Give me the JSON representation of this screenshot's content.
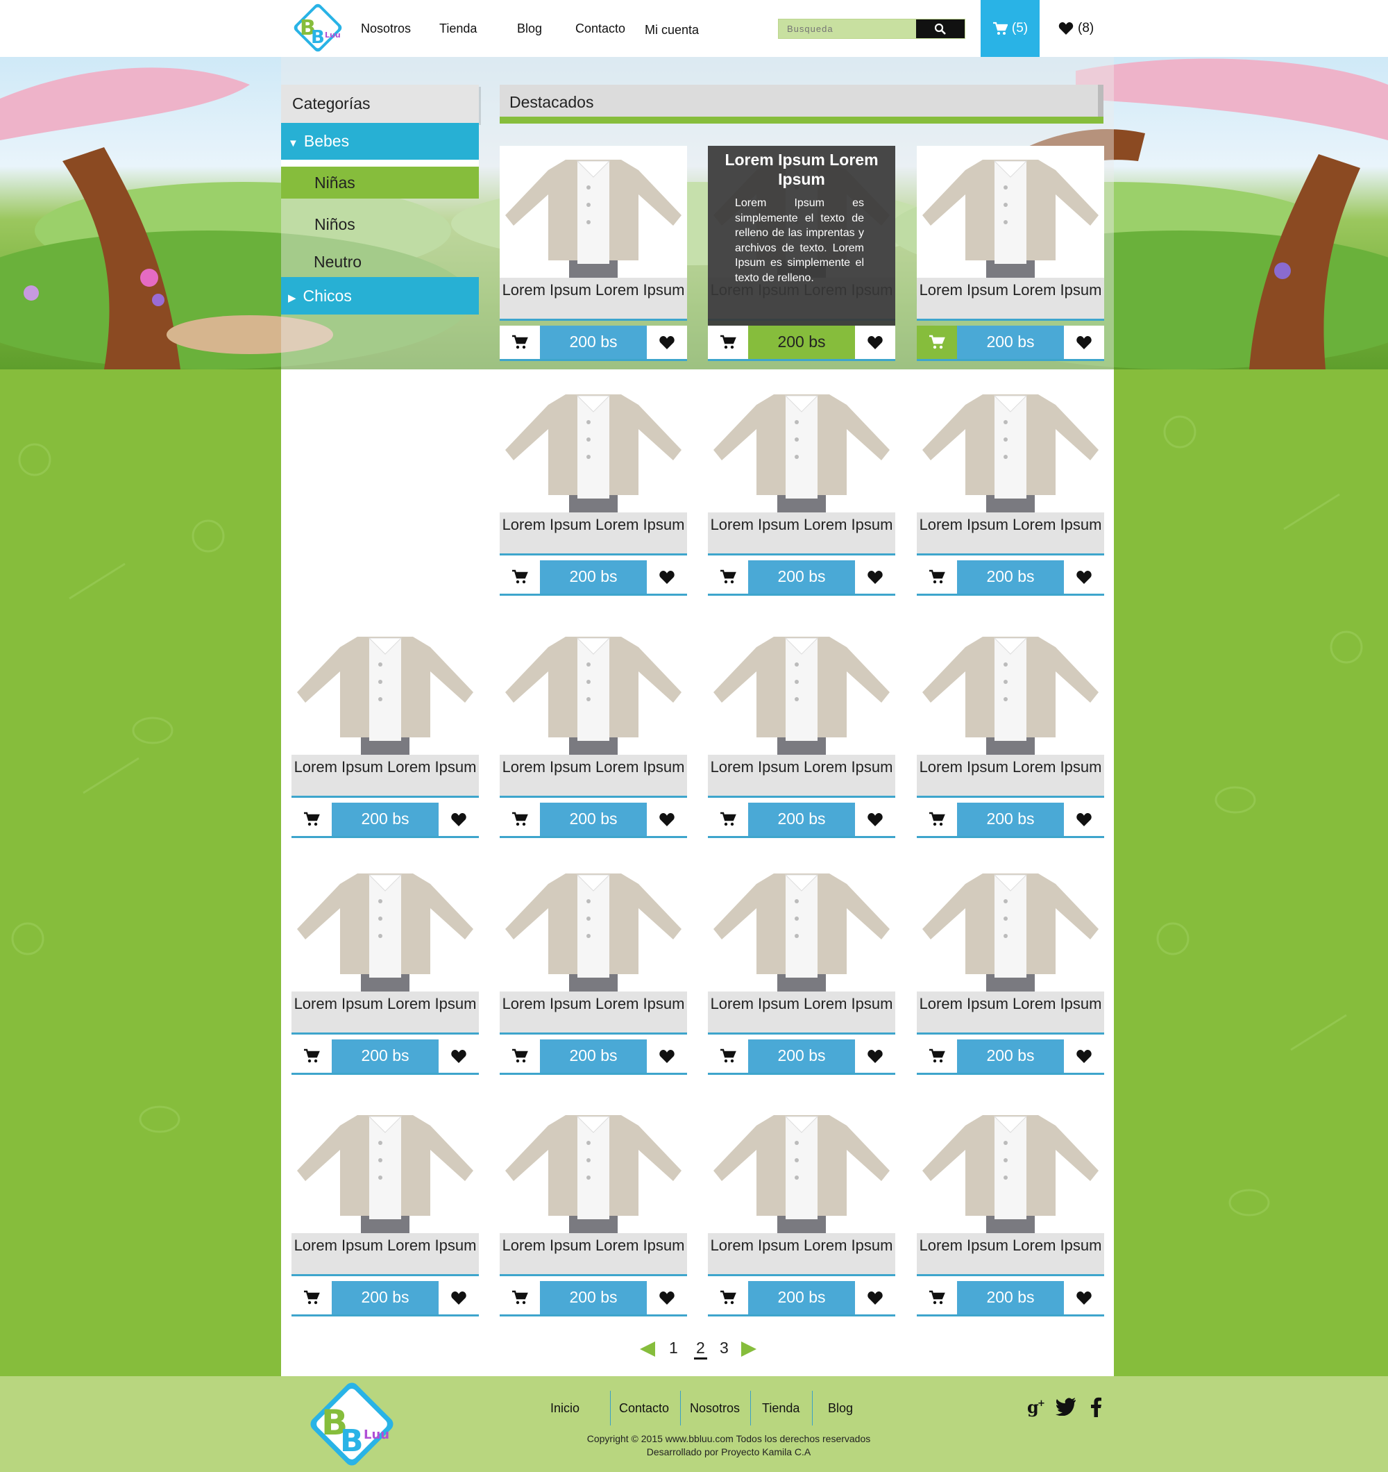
{
  "nav": {
    "logo_text": "BBLuu",
    "links": [
      "Nosotros",
      "Tienda",
      "Blog",
      "Contacto",
      "Mi cuenta"
    ],
    "search_placeholder": "Busqueda",
    "cart_count": "(5)",
    "wishlist_count": "(8)"
  },
  "sidebar": {
    "title": "Categorías",
    "items": [
      {
        "label": "Bebes"
      },
      {
        "label": "Niñas"
      },
      {
        "label": "Niños"
      },
      {
        "label": "Neutro"
      },
      {
        "label": "Chicos"
      }
    ]
  },
  "featured": {
    "title": "Destacados",
    "hover_title": "Lorem Ipsum Lorem Ipsum",
    "hover_text": "Lorem Ipsum es simplemente el texto de relleno de las imprentas y archivos de texto. Lorem Ipsum es simplemente el texto de relleno."
  },
  "product": {
    "name": "Lorem Ipsum Lorem Ipsum",
    "price": "200 bs"
  },
  "pagination": {
    "pages": [
      "1",
      "2",
      "3"
    ],
    "current": "2"
  },
  "footer": {
    "links": [
      "Inicio",
      "Contacto",
      "Nosotros",
      "Tienda",
      "Blog"
    ],
    "copyright": "Copyright © 2015 www.bbluu.com Todos los derechos reservados",
    "developer": "Desarrollado por Proyecto Kamila C.A"
  },
  "colors": {
    "accent_blue": "#29b3e6",
    "price_blue": "#4aa9d6",
    "green": "#86bd3c",
    "footer_green": "#b8d67f"
  },
  "icons": [
    "cart-icon",
    "heart-icon",
    "search-icon",
    "google-plus-icon",
    "twitter-icon",
    "facebook-icon",
    "arrow-left-icon",
    "arrow-right-icon"
  ]
}
